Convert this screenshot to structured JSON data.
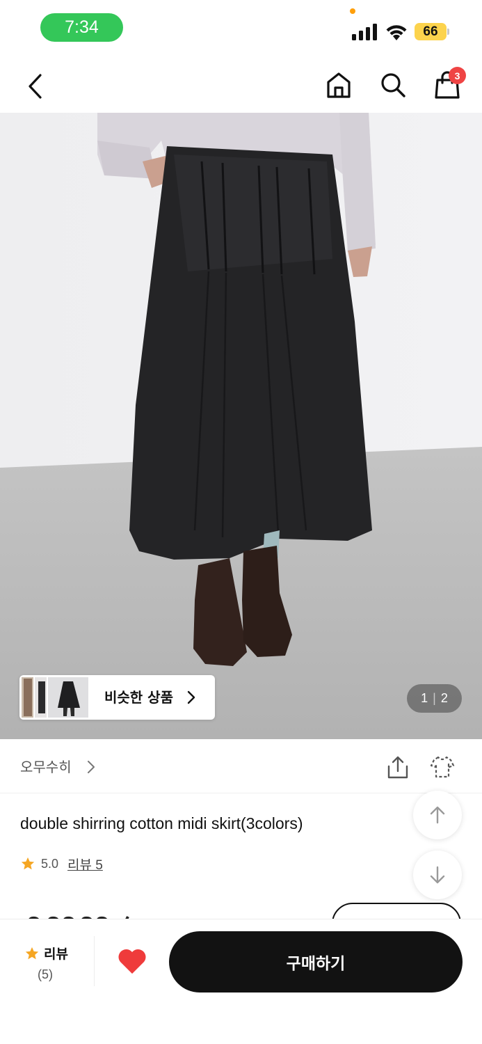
{
  "status_bar": {
    "time": "7:34",
    "battery": "66"
  },
  "top_nav": {
    "cart_count": "3"
  },
  "gallery": {
    "similar_label": "비슷한 상품",
    "current_page": "1",
    "total_pages": "2"
  },
  "brand": {
    "name": "오무수히"
  },
  "product": {
    "title": "double shirring cotton midi skirt(3colors)",
    "rating": "5.0",
    "review_link": "리뷰 5"
  },
  "bottom_bar": {
    "review_label": "리뷰",
    "review_count": "(5)",
    "buy_label": "구매하기"
  },
  "colors": {
    "status_pill": "#34c759",
    "battery": "#fcd34d",
    "badge": "#ef4444",
    "heart": "#ef3b3b",
    "star": "#f5a623",
    "buy_button": "#121212"
  }
}
